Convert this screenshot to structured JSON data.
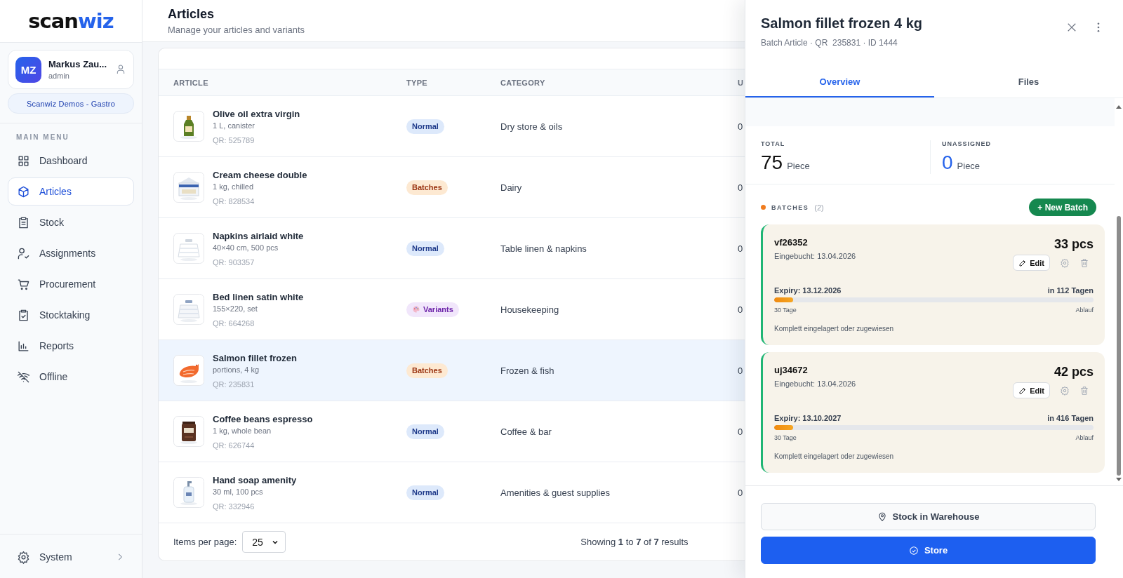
{
  "logo": {
    "part_1": "scan",
    "part_2": "wiz"
  },
  "user": {
    "initials": "MZ",
    "name": "Markus Zau...",
    "role": "admin"
  },
  "organization": "Scanwiz Demos - Gastro",
  "menu_heading": "MAIN MENU",
  "menu": [
    {
      "label": "Dashboard",
      "selected": false
    },
    {
      "label": "Articles",
      "selected": true
    },
    {
      "label": "Stock",
      "selected": false
    },
    {
      "label": "Assignments",
      "selected": false
    },
    {
      "label": "Procurement",
      "selected": false
    },
    {
      "label": "Stocktaking",
      "selected": false
    },
    {
      "label": "Reports",
      "selected": false
    },
    {
      "label": "Offline",
      "selected": false
    }
  ],
  "system_item": {
    "label": "System"
  },
  "page": {
    "title": "Articles",
    "subtitle": "Manage your articles and variants"
  },
  "table": {
    "columns": [
      "ARTICLE",
      "TYPE",
      "CATEGORY",
      "U"
    ],
    "rows": [
      {
        "name": "Olive oil extra virgin",
        "details": "1 L, canister",
        "qr": "QR: 525789",
        "type": {
          "kind": "normal",
          "label": "Normal"
        },
        "category": "Dry store & oils",
        "column_4": "0",
        "selected": false
      },
      {
        "name": "Cream cheese double",
        "details": "1 kg, chilled",
        "qr": "QR: 828534",
        "type": {
          "kind": "batches",
          "label": "Batches"
        },
        "category": "Dairy",
        "column_4": "0",
        "selected": false
      },
      {
        "name": "Napkins airlaid white",
        "details": "40×40 cm, 500 pcs",
        "qr": "QR: 903357",
        "type": {
          "kind": "normal",
          "label": "Normal"
        },
        "category": "Table linen & napkins",
        "column_4": "0",
        "selected": false
      },
      {
        "name": "Bed linen satin white",
        "details": "155×220, set",
        "qr": "QR: 664268",
        "type": {
          "kind": "variants",
          "label": "Variants"
        },
        "category": "Housekeeping",
        "column_4": "0",
        "selected": false
      },
      {
        "name": "Salmon fillet frozen",
        "details": "portions, 4 kg",
        "qr": "QR: 235831",
        "type": {
          "kind": "batches",
          "label": "Batches"
        },
        "category": "Frozen & fish",
        "column_4": "0",
        "selected": true
      },
      {
        "name": "Coffee beans espresso",
        "details": "1 kg, whole bean",
        "qr": "QR: 626744",
        "type": {
          "kind": "normal",
          "label": "Normal"
        },
        "category": "Coffee & bar",
        "column_4": "0",
        "selected": false
      },
      {
        "name": "Hand soap amenity",
        "details": "30 ml, 100 pcs",
        "qr": "QR: 332946",
        "type": {
          "kind": "normal",
          "label": "Normal"
        },
        "category": "Amenities & guest supplies",
        "column_4": "0",
        "selected": false
      }
    ]
  },
  "pagination": {
    "label": "Items per page:",
    "page_size": "25",
    "summary": "Showing **1** to **7** of **7** results"
  },
  "drawer": {
    "title": "Salmon fillet frozen 4 kg",
    "subtitle": "Batch Article · QR  235831 · ID 1444",
    "tabs": [
      {
        "label": "Overview",
        "selected": true
      },
      {
        "label": "Files",
        "selected": false
      }
    ],
    "stats": [
      {
        "label": "TOTAL",
        "value": "75",
        "unit": "Piece",
        "kind": "total"
      },
      {
        "label": "UNASSIGNED",
        "value": "0",
        "unit": "Piece",
        "kind": "unassigned"
      }
    ],
    "batches_heading": "BATCHES",
    "batches_count": "(2)",
    "new_batch": "+ New Batch",
    "batches": [
      {
        "code": "vf26352",
        "booked": "Eingebucht: 13.04.2026",
        "quantity": "33 pcs",
        "edit": "Edit",
        "expiry": "Expiry: 13.12.2026",
        "remaining": "in 112 Tagen",
        "level": 0.06,
        "scale_start": "30 Tage",
        "scale_end": "Ablauf",
        "status": "Komplett eingelagert oder zugewiesen"
      },
      {
        "code": "uj34672",
        "booked": "Eingebucht: 13.04.2026",
        "quantity": "42 pcs",
        "edit": "Edit",
        "expiry": "Expiry: 13.10.2027",
        "remaining": "in 416 Tagen",
        "level": 0.06,
        "scale_start": "30 Tage",
        "scale_end": "Ablauf",
        "status": "Komplett eingelagert oder zugewiesen"
      }
    ],
    "actions": [
      {
        "label": "Stock in Warehouse",
        "kind": "secondary"
      },
      {
        "label": "Store",
        "kind": "primary"
      }
    ]
  }
}
